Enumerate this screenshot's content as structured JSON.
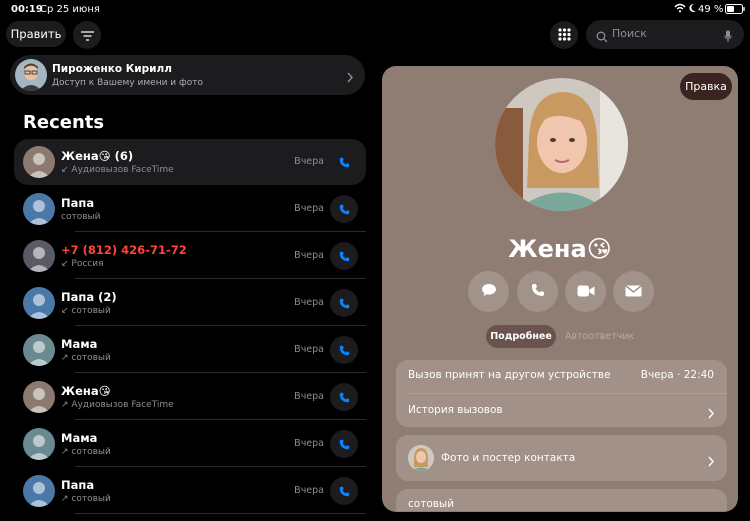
{
  "status": {
    "time": "00:19",
    "date": "Ср 25 июня",
    "battery": "49 %"
  },
  "toolbar": {
    "edit_label": "Править",
    "filter_icon": "filter-lines-icon",
    "keypad_icon": "keypad-grid-icon",
    "search_placeholder": "Поиск"
  },
  "profile": {
    "name": "Пироженко Кирилл",
    "subtitle": "Доступ к Вашему имени и фото"
  },
  "recents": {
    "title": "Recents",
    "items": [
      {
        "name": "Жена😘 (6)",
        "sub": "Аудиовызов FaceTime",
        "time": "Вчера",
        "missed": false,
        "direction": "in",
        "avatar": "#8a7a70"
      },
      {
        "name": "Папа",
        "sub": "сотовый",
        "time": "Вчера",
        "missed": false,
        "direction": "none",
        "avatar": "#4a78a8"
      },
      {
        "name": "+7 (812) 426-71-72",
        "sub": "Россия",
        "time": "Вчера",
        "missed": true,
        "direction": "in",
        "avatar": "#5a5a66"
      },
      {
        "name": "Папа (2)",
        "sub": "сотовый",
        "time": "Вчера",
        "missed": false,
        "direction": "in",
        "avatar": "#4a78a8"
      },
      {
        "name": "Мама",
        "sub": "сотовый",
        "time": "Вчера",
        "missed": false,
        "direction": "out",
        "avatar": "#6a8a92"
      },
      {
        "name": "Жена😘",
        "sub": "Аудиовызов FaceTime",
        "time": "Вчера",
        "missed": false,
        "direction": "out",
        "avatar": "#8a7a70"
      },
      {
        "name": "Мама",
        "sub": "сотовый",
        "time": "Вчера",
        "missed": false,
        "direction": "out",
        "avatar": "#6a8a92"
      },
      {
        "name": "Папа",
        "sub": "сотовый",
        "time": "Вчера",
        "missed": false,
        "direction": "out",
        "avatar": "#4a78a8"
      }
    ]
  },
  "detail": {
    "edit_label": "Правка",
    "name": "Жена😘",
    "tabs": {
      "details": "Подробнее",
      "voicemail": "Автоответчик"
    },
    "call_info": {
      "text": "Вызов принят на другом устройстве",
      "time": "Вчера · 22:40"
    },
    "history_label": "История вызовов",
    "photo_label": "Фото и постер контакта",
    "phone_label": "сотовый",
    "colors": {
      "panel": "#8f7c73",
      "accent": "#0a84ff",
      "missed": "#ff453a"
    }
  }
}
